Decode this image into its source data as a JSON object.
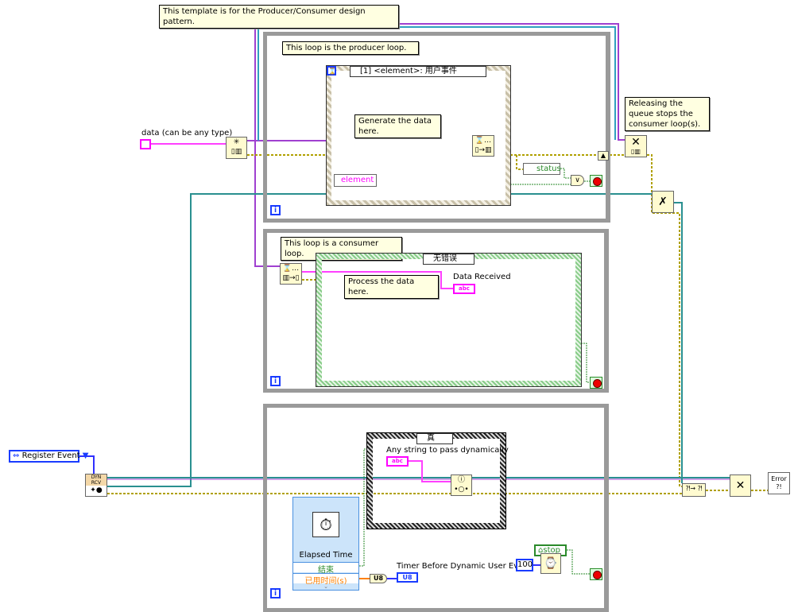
{
  "comments": {
    "template": "This template is for the Producer/Consumer design pattern.",
    "producer": "This loop is the producer loop.",
    "generate": "Generate the data here.",
    "release": "Releasing the queue stops the consumer loop(s).",
    "consumer": "This loop is a consumer loop.",
    "process": "Process the data here."
  },
  "producer": {
    "event_selector": "[1] <element>: 用户事件",
    "element_label": "element",
    "status_label": "status",
    "or_label": "∨"
  },
  "consumer": {
    "case_selector": "无错误",
    "indicator_label": "Data Received",
    "indicator_type": "abc"
  },
  "left": {
    "data_label": "data (can be any type)",
    "register_event": "Register Event",
    "reg_node_label": "DYN RCV"
  },
  "bottom": {
    "case_selector": "真",
    "string_label": "Any string to pass dynamically",
    "string_type": "abc",
    "elapsed_title": "Elapsed Time",
    "elapsed_out1": "结束",
    "elapsed_out2": "已用时间(s)",
    "convert": "U8",
    "timer_label": "Timer Before Dynamic User Event",
    "timer_type": "U8",
    "stop_label": "stop",
    "wait_const": "100"
  },
  "right": {
    "error_handler": "Error ?!"
  },
  "loop_iteration": "i",
  "colors": {
    "queue_wire": "#a040d0",
    "event_wire": "#2a9090",
    "error_wire": "#b0a000",
    "string_wire": "#ff40ff",
    "bool_wire": "#2a8a2a",
    "loop_border": "#9a9a9a"
  }
}
